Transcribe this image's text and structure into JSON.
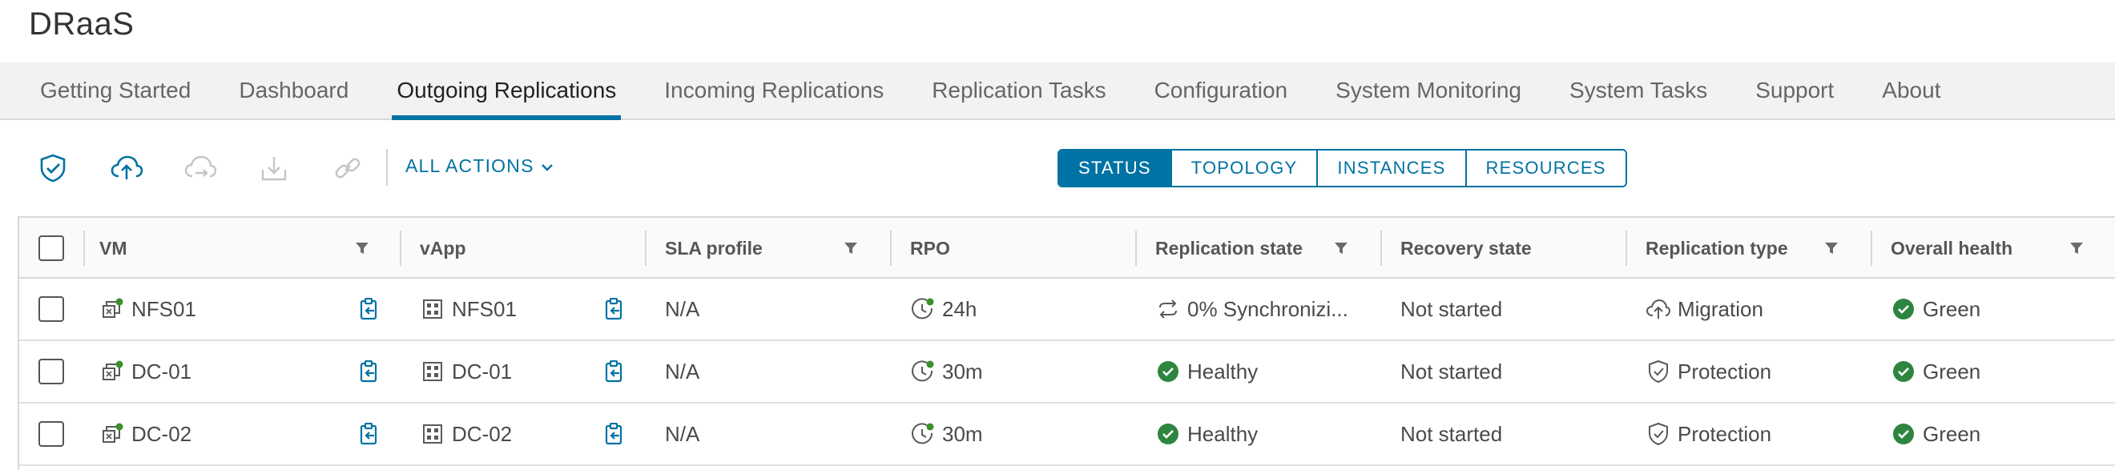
{
  "app": {
    "title": "DRaaS"
  },
  "tabs": [
    {
      "label": "Getting Started",
      "active": false
    },
    {
      "label": "Dashboard",
      "active": false
    },
    {
      "label": "Outgoing Replications",
      "active": true
    },
    {
      "label": "Incoming Replications",
      "active": false
    },
    {
      "label": "Replication Tasks",
      "active": false
    },
    {
      "label": "Configuration",
      "active": false
    },
    {
      "label": "System Monitoring",
      "active": false
    },
    {
      "label": "System Tasks",
      "active": false
    },
    {
      "label": "Support",
      "active": false
    },
    {
      "label": "About",
      "active": false
    }
  ],
  "toolbar": {
    "icons": [
      "shield-check-icon",
      "cloud-upload-icon",
      "cloud-sync-icon",
      "download-icon",
      "link-icon"
    ],
    "all_actions_label": "ALL ACTIONS",
    "views": [
      "STATUS",
      "TOPOLOGY",
      "INSTANCES",
      "RESOURCES"
    ],
    "active_view": "STATUS"
  },
  "table": {
    "columns": [
      "VM",
      "vApp",
      "SLA profile",
      "RPO",
      "Replication state",
      "Recovery state",
      "Replication type",
      "Overall health"
    ],
    "rows": [
      {
        "vm": "NFS01",
        "vapp": "NFS01",
        "sla": "N/A",
        "rpo": "24h",
        "replication_state": "0% Synchronizi...",
        "replication_state_icon": "sync-icon",
        "recovery_state": "Not started",
        "replication_type": "Migration",
        "replication_type_icon": "cloud-upload-icon",
        "health": "Green"
      },
      {
        "vm": "DC-01",
        "vapp": "DC-01",
        "sla": "N/A",
        "rpo": "30m",
        "replication_state": "Healthy",
        "replication_state_icon": "check-circle-icon",
        "recovery_state": "Not started",
        "replication_type": "Protection",
        "replication_type_icon": "shield-icon",
        "health": "Green"
      },
      {
        "vm": "DC-02",
        "vapp": "DC-02",
        "sla": "N/A",
        "rpo": "30m",
        "replication_state": "Healthy",
        "replication_state_icon": "check-circle-icon",
        "recovery_state": "Not started",
        "replication_type": "Protection",
        "replication_type_icon": "shield-icon",
        "health": "Green"
      }
    ]
  },
  "colors": {
    "accent": "#0072a3",
    "success": "#2e8540",
    "status_dot": "#3c8f2c"
  }
}
